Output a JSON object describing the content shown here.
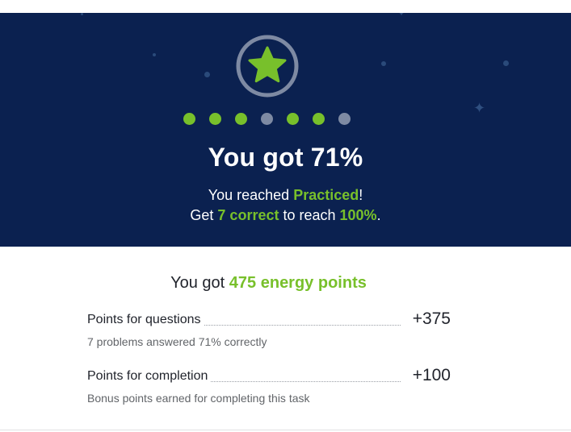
{
  "colors": {
    "hero_bg": "#0b2150",
    "accent_green": "#78c02b",
    "inactive_dot": "#7e8aa3",
    "badge_ring": "#7e8aa3"
  },
  "hero": {
    "badge_icon": "star-icon",
    "progress": {
      "total": 7,
      "correct": 5,
      "states": [
        "correct",
        "correct",
        "correct",
        "incorrect",
        "correct",
        "correct",
        "incorrect"
      ]
    },
    "title": "You got 71%",
    "line1_prefix": "You reached ",
    "line1_level": "Practiced",
    "line1_suffix": "!",
    "line2_prefix": "Get ",
    "line2_count": "7 correct",
    "line2_mid": " to reach ",
    "line2_target": "100%",
    "line2_suffix": "."
  },
  "points": {
    "title_prefix": "You got ",
    "title_amount": "475 energy points",
    "rows": [
      {
        "label": "Points for questions",
        "value": "+375",
        "sub": "7 problems answered 71% correctly"
      },
      {
        "label": "Points for completion",
        "value": "+100",
        "sub": "Bonus points earned for completing this task"
      }
    ]
  }
}
